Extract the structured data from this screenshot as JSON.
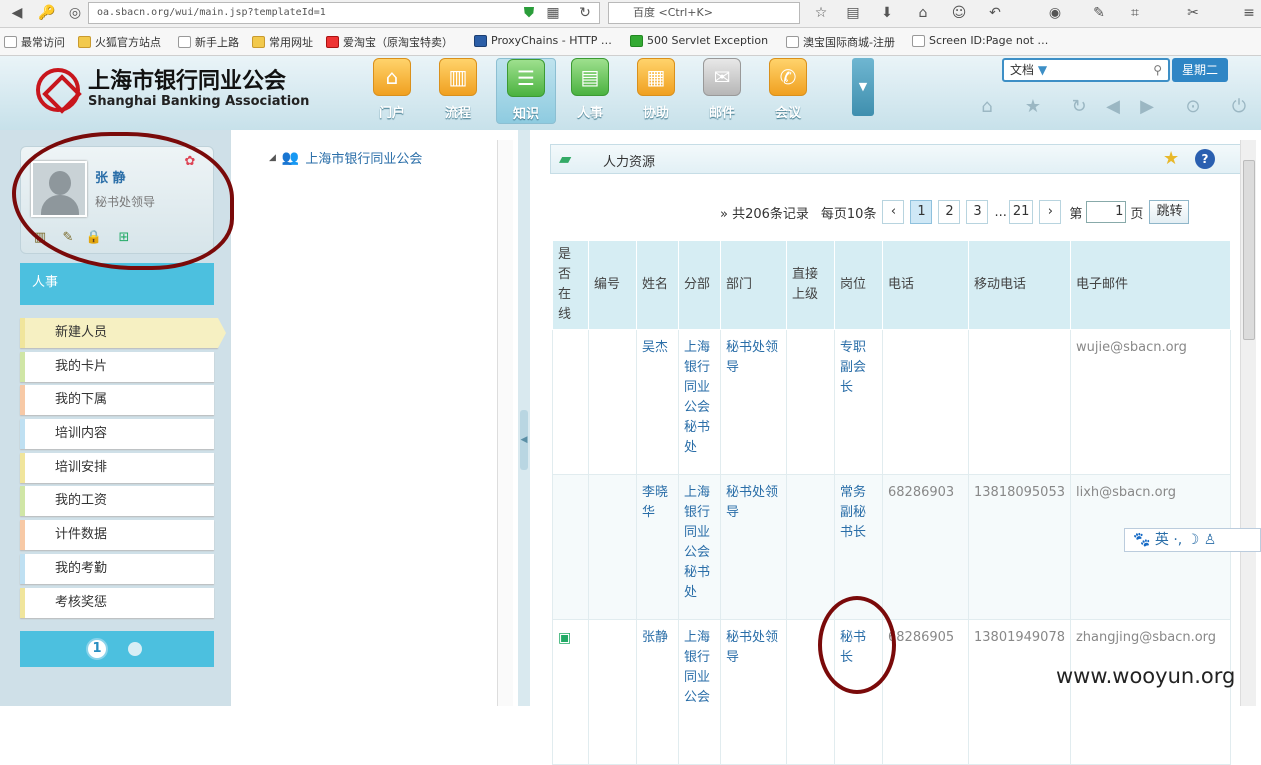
{
  "browser": {
    "url": "oa.sbacn.org/wui/main.jsp?templateId=1",
    "search_placeholder": "百度 <Ctrl+K>",
    "bookmarks": [
      "最常访问",
      "火狐官方站点",
      "新手上路",
      "常用网址",
      "爱淘宝（原淘宝特卖）",
      "ProxyChains - HTTP …",
      "500 Servlet Exception",
      "澳宝国际商城-注册",
      "Screen ID:Page not …"
    ]
  },
  "header": {
    "logo_cn": "上海市银行同业公会",
    "logo_en": "Shanghai Banking Association",
    "nav": [
      {
        "label": "门户",
        "icon": "home-icon",
        "glyph": "⌂"
      },
      {
        "label": "流程",
        "icon": "chart-icon",
        "glyph": "▥"
      },
      {
        "label": "知识",
        "icon": "server-icon",
        "glyph": "☰"
      },
      {
        "label": "人事",
        "icon": "card-icon",
        "glyph": "▤"
      },
      {
        "label": "协助",
        "icon": "clipboard-icon",
        "glyph": "▦"
      },
      {
        "label": "邮件",
        "icon": "mail-icon",
        "glyph": "✉"
      },
      {
        "label": "会议",
        "icon": "phone-icon",
        "glyph": "✆"
      }
    ],
    "search_scope": "文档",
    "weekday": "星期二"
  },
  "profile": {
    "name": "张 静",
    "role": "秘书处领导"
  },
  "sidebar": {
    "section": "人事",
    "items": [
      "新建人员",
      "我的卡片",
      "我的下属",
      "培训内容",
      "培训安排",
      "我的工资",
      "计件数据",
      "我的考勤",
      "考核奖惩"
    ],
    "active_index": 0,
    "page": "1",
    "accent_colors": [
      "#d0e6a6",
      "#f7c9a6",
      "#bfe0f2",
      "#f0e59c",
      "#d0e6a6",
      "#f7c9a6",
      "#bfe0f2",
      "#f0e59c",
      "#d0e6a6"
    ]
  },
  "tree": {
    "root": "上海市银行同业公会"
  },
  "panel": {
    "title": "人力资源",
    "pager": {
      "prefix": "» 共206条记录",
      "per_page": "每页10条",
      "pages": [
        "1",
        "2",
        "3"
      ],
      "ellipsis": "...",
      "last": "21",
      "current": "1",
      "before_input": "第",
      "after_input": "页",
      "jump": "跳转"
    },
    "columns": [
      "是否在线",
      "编号",
      "姓名",
      "分部",
      "部门",
      "直接上级",
      "岗位",
      "电话",
      "移动电话",
      "电子邮件"
    ],
    "rows": [
      {
        "online": "",
        "id": "",
        "name": "吴杰",
        "branch": "上海银行同业公会秘书处",
        "dept": "秘书处领导",
        "boss": "",
        "post": "专职副会长",
        "phone": "",
        "mobile": "",
        "email": "wujie@sbacn.org"
      },
      {
        "online": "",
        "id": "",
        "name": "李晓华",
        "branch": "上海银行同业公会秘书处",
        "dept": "秘书处领导",
        "boss": "",
        "post": "常务副秘书长",
        "phone": "68286903",
        "mobile": "13818095053",
        "email": "lixh@sbacn.org"
      },
      {
        "online": "online",
        "id": "",
        "name": "张静",
        "branch": "上海银行同业公会",
        "dept": "秘书处领导",
        "boss": "",
        "post": "秘书长",
        "phone": "68286905",
        "mobile": "13801949078",
        "email": "zhangjing@sbacn.org"
      }
    ]
  },
  "ime": {
    "text": "英 ·, ☽ ♙"
  },
  "watermark": "www.wooyun.org"
}
